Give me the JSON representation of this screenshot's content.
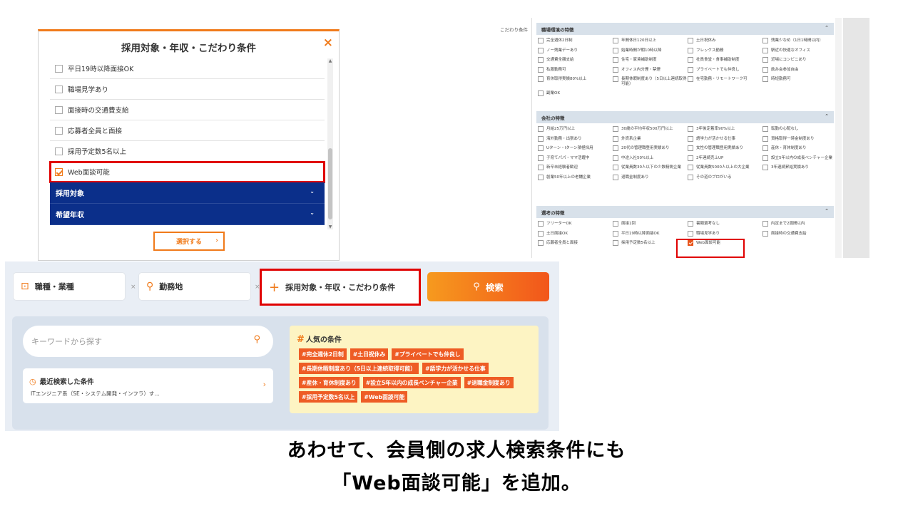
{
  "modal": {
    "title": "採用対象・年収・こだわり条件",
    "close": "×",
    "rows": [
      {
        "label": "平日19時以降面接OK",
        "checked": false
      },
      {
        "label": "職場見学あり",
        "checked": false
      },
      {
        "label": "面接時の交通費支給",
        "checked": false
      },
      {
        "label": "応募者全員と面接",
        "checked": false
      },
      {
        "label": "採用予定数5名以上",
        "checked": false
      },
      {
        "label": "Web面談可能",
        "checked": true
      }
    ],
    "bands": [
      "採用対象",
      "希望年収"
    ],
    "select_button": "選択する"
  },
  "admin": {
    "side_label": "こだわり条件",
    "sections": [
      {
        "title": "職場環境の特徴",
        "items": [
          "完全週休2日制",
          "年間休日120日以上",
          "土日祝休み",
          "残業少なめ（1日1時間以内）",
          "ノー残業デーあり",
          "始業時間が朝10時以降",
          "フレックス勤務",
          "駅近の快適なオフィス",
          "交通費全額支給",
          "住宅・家賃補助制度",
          "社員食堂・食事補助制度",
          "近場にコンビニあり",
          "私服勤務可",
          "オフィス内分煙・禁煙",
          "プライベートでも仲良し",
          "飲み会参加自由",
          "育休取得実績80%以上",
          "長期休暇制度あり（5日以上連続取得可能）",
          "在宅勤務・リモートワーク可",
          "時短勤務可",
          "副業OK"
        ]
      },
      {
        "title": "会社の特徴",
        "items": [
          "月給25万円以上",
          "30歳の平均年収500万円以上",
          "3年後定着率90%以上",
          "転勤の心配なし",
          "海外勤務・出張あり",
          "外資系企業",
          "語学力が活かせる仕事",
          "資格取得一時金制度あり",
          "Uターン・Iターン積極採用",
          "20代の管理職登用実績あり",
          "女性の管理職登用実績あり",
          "産休・育休制度あり",
          "子育てパパ・ママ活躍中",
          "中途入社50%以上",
          "2年連続売上UP",
          "設立5年以内の成長ベンチャー企業",
          "新卒未経験者歓迎",
          "従業員数30人以下の少数精鋭企業",
          "従業員数5000人以上の大企業",
          "3年連続昇給実績あり",
          "創業50年以上の老舗企業",
          "退職金制度あり",
          "その道のプロがいる"
        ]
      },
      {
        "title": "選考の特徴",
        "items": [
          "フリーターOK",
          "面接1回",
          "書類選考なし",
          "内定まで2週間以内",
          "土日面接OK",
          "平日19時以降面接OK",
          "職場見学あり",
          "面接時の交通費支給",
          "応募者全員と面接",
          "採用予定数5名以上",
          "Web面談可能"
        ]
      }
    ]
  },
  "search": {
    "job_type": "職種・業種",
    "location": "勤務地",
    "conditions": "採用対象・年収・こだわり条件",
    "times": "×",
    "search_button": "検索",
    "keyword_placeholder": "キーワードから探す",
    "recent_title": "最近検索した条件",
    "recent_summary": "ITエンジニア系（SE・システム開発・インフラ）す…",
    "popular_title": "人気の条件",
    "popular_tags": [
      "#完全週休2日制",
      "#土日祝休み",
      "#プライベートでも仲良し",
      "#長期休暇制度あり（5日以上連続取得可能）",
      "#語学力が活かせる仕事",
      "#産休・育休制度あり",
      "#設立5年以内の成長ベンチャー企業",
      "#退職金制度あり",
      "#採用予定数5名以上",
      "#Web面談可能"
    ]
  },
  "caption": {
    "line1": "あわせて、会員側の求人検索条件にも",
    "line2": "「Web面談可能」を追加。"
  },
  "colors": {
    "accent": "#f07a1a",
    "navy": "#0b2f8a",
    "highlight": "#e00000",
    "tag": "#ee5c25"
  }
}
